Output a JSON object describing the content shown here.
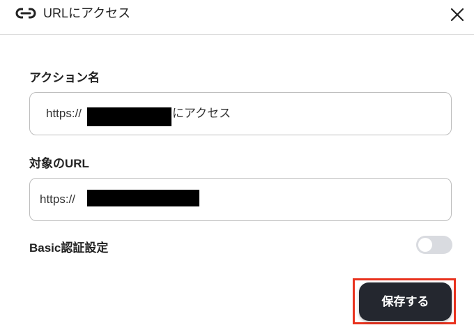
{
  "dialog": {
    "title": "URLにアクセス",
    "icon": "link-icon",
    "close_icon": "close-icon"
  },
  "form": {
    "action_name": {
      "label": "アクション名",
      "value_prefix": "https://",
      "value_suffix": "にアクセス"
    },
    "target_url": {
      "label": "対象のURL",
      "value_prefix": "https://"
    },
    "basic_auth": {
      "label": "Basic認証設定",
      "enabled": false
    }
  },
  "footer": {
    "save_label": "保存する"
  },
  "colors": {
    "primary_button": "#24272f",
    "highlight": "#e8321e",
    "toggle_off": "#d9dbe0"
  }
}
